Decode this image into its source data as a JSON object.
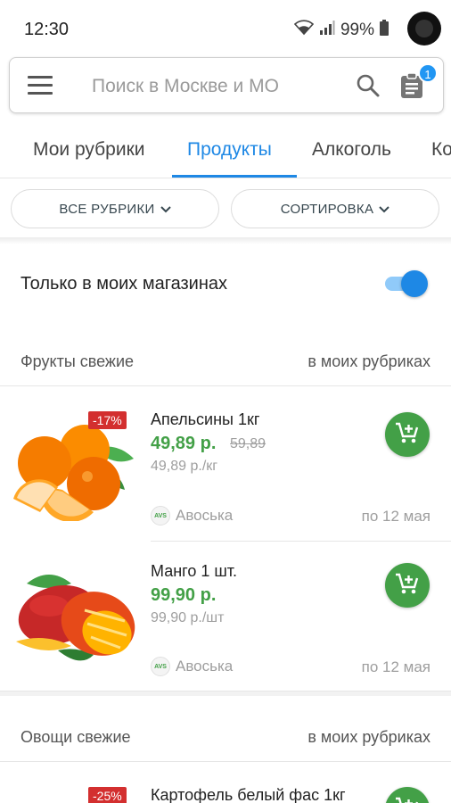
{
  "status": {
    "time": "12:30",
    "battery": "99%",
    "icons": [
      "wifi-icon",
      "signal-icon",
      "battery-icon"
    ]
  },
  "search": {
    "placeholder": "Поиск в Москве и МО",
    "list_badge": "1"
  },
  "tabs": [
    {
      "label": "Мои рубрики",
      "active": false
    },
    {
      "label": "Продукты",
      "active": true
    },
    {
      "label": "Алкоголь",
      "active": false
    },
    {
      "label": "Ко",
      "active": false
    }
  ],
  "filters": {
    "rubrics": "ВСЕ РУБРИКИ",
    "sort": "СОРТИРОВКА"
  },
  "toggle": {
    "label": "Только в моих магазинах",
    "on": true
  },
  "sections": [
    {
      "title": "Фрукты свежие",
      "link": "в моих рубриках",
      "products": [
        {
          "name": "Апельсины 1кг",
          "price": "49,89 р.",
          "old_price": "59,89",
          "unit_price": "49,89 р./кг",
          "store": "Авоська",
          "date": "по 12 мая",
          "discount": "-17%"
        },
        {
          "name": "Манго 1 шт.",
          "price": "99,90 р.",
          "old_price": "",
          "unit_price": "99,90 р./шт",
          "store": "Авоська",
          "date": "по 12 мая",
          "discount": ""
        }
      ]
    },
    {
      "title": "Овощи свежие",
      "link": "в моих рубриках",
      "products": [
        {
          "name": "Картофель белый фас 1кг",
          "discount": "-25%"
        }
      ]
    }
  ],
  "colors": {
    "accent": "#1e88e5",
    "price_green": "#43a047",
    "discount_red": "#d32f2f"
  }
}
